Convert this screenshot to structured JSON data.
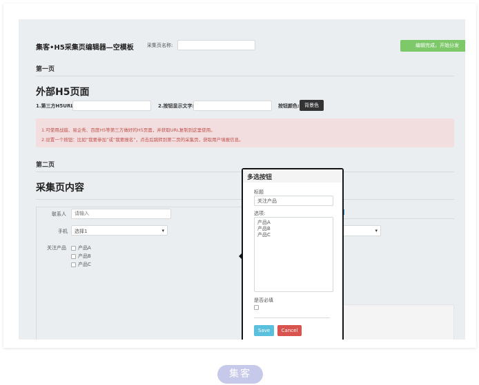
{
  "header": {
    "title": "集客•H5采集页编辑器—空模板",
    "name_label": "采集页名称:",
    "name_value": "",
    "finish_button": "编辑完成，开始分发"
  },
  "page1": {
    "heading": "第一页",
    "section_title": "外部H5页面",
    "url_label": "1.第三方H5URL:",
    "url_value": "",
    "btn_text_label": "2.按钮显示文字:",
    "btn_text_value": "",
    "btn_color_label": "按钮颜色:",
    "btn_color_button": "背景色",
    "alert": [
      "1.可使用战鼓、易企秀、百度H5等第三方做好的H5页面，并获取URL复制到这里使用。",
      "2.设置一个按钮：比如“我要参加”或“我要报名”，点击后跳转到第二页的采集页，获取用户填报信息。"
    ]
  },
  "page2": {
    "heading": "第二页",
    "section_title": "采集页内容",
    "form": {
      "contact_label": "联系人",
      "contact_placeholder": "请输入",
      "phone_label": "手机",
      "phone_value": "选择1",
      "products_label": "关注产品",
      "products": [
        "产品A",
        "产品B",
        "产品C"
      ]
    }
  },
  "popover": {
    "title": "多选按钮",
    "title_label": "标题",
    "title_value": "关注产品",
    "options_label": "选项:",
    "options": [
      "产品A",
      "产品B",
      "产品C"
    ],
    "required_label": "是否必填",
    "required_checked": false,
    "save": "Save",
    "cancel": "Cancel"
  },
  "footer": {
    "logo": "集客"
  },
  "colors": {
    "success": "#7dc96a",
    "alert_bg": "#f2dede",
    "alert_text": "#c0504d",
    "save": "#5bc0de",
    "cancel": "#d9534f"
  }
}
